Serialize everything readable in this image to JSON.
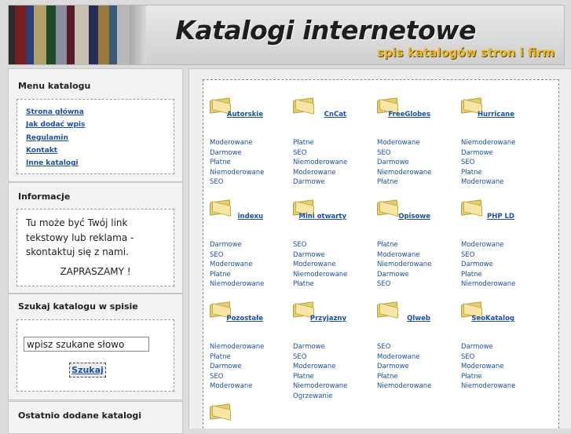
{
  "header": {
    "title": "Katalogi internetowe",
    "subtitle": "spis katalogów stron i firm"
  },
  "menu": {
    "title": "Menu katalogu",
    "items": [
      {
        "label": "Strona główna"
      },
      {
        "label": "Jak dodać wpis"
      },
      {
        "label": "Regulamin"
      },
      {
        "label": "Kontakt"
      },
      {
        "label": "Inne katalogi"
      }
    ]
  },
  "info": {
    "title": "Informacje",
    "text": "Tu może być Twój link tekstowy lub reklama - skontaktuj się z nami.",
    "cta": "ZAPRASZAMY !"
  },
  "search": {
    "title": "Szukaj katalogu w spisie",
    "value": "wpisz szukane słowo",
    "button": "Szukaj"
  },
  "recent": {
    "title": "Ostatnio dodane katalogi"
  },
  "categories": [
    {
      "name": "Autorskie",
      "tags": [
        "Moderowane",
        "Darmowe",
        "Płatne",
        "Niemoderowane",
        "SEO"
      ]
    },
    {
      "name": "CnCat",
      "tags": [
        "Płatne",
        "SEO",
        "Niemoderowane",
        "Moderowane",
        "Darmowe"
      ]
    },
    {
      "name": "FreeGlobes",
      "tags": [
        "Moderowane",
        "SEO",
        "Darmowe",
        "Niemoderowane",
        "Płatne"
      ]
    },
    {
      "name": "Hurricane",
      "tags": [
        "Niemoderowane",
        "Darmowe",
        "SEO",
        "Płatne",
        "Moderowane"
      ]
    },
    {
      "name": "indexu",
      "tags": [
        "Darmowe",
        "SEO",
        "Moderowane",
        "Płatne",
        "Niemoderowane"
      ]
    },
    {
      "name": "Mini otwarty",
      "tags": [
        "SEO",
        "Darmowe",
        "Moderowane",
        "Niemoderowane",
        "Płatne"
      ]
    },
    {
      "name": "Opisowe",
      "tags": [
        "Płatne",
        "Moderowane",
        "Niemoderowane",
        "Darmowe",
        "SEO"
      ]
    },
    {
      "name": "PHP LD",
      "tags": [
        "Moderowane",
        "SEO",
        "Darmowe",
        "Płatne",
        "Niemoderowane"
      ]
    },
    {
      "name": "Pozostałe",
      "tags": [
        "Niemoderowane",
        "Płatne",
        "Darmowe",
        "SEO",
        "Moderowane"
      ]
    },
    {
      "name": "Przyjazny",
      "tags": [
        "Darmowe",
        "SEO",
        "Moderowane",
        "Płatne",
        "Niemoderowane",
        "Ogrzewanie"
      ]
    },
    {
      "name": "Qlweb",
      "tags": [
        "SEO",
        "Moderowane",
        "Darmowe",
        "Płatne",
        "Niemoderowane"
      ]
    },
    {
      "name": "SeoKatalog",
      "tags": [
        "Darmowe",
        "SEO",
        "Moderowane",
        "Płatne",
        "Niemoderowane"
      ]
    }
  ]
}
